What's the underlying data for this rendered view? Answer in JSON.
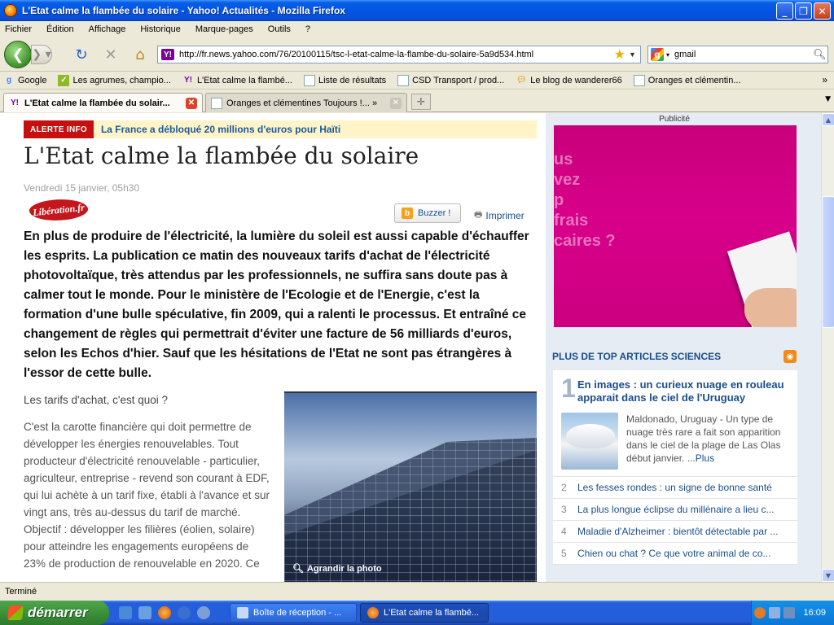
{
  "window": {
    "title": "L'Etat calme la flambée du solaire - Yahoo! Actualités - Mozilla Firefox"
  },
  "menu": [
    "Fichier",
    "Édition",
    "Affichage",
    "Historique",
    "Marque-pages",
    "Outils",
    "?"
  ],
  "nav": {
    "url": "http://fr.news.yahoo.com/76/20100115/tsc-l-etat-calme-la-flambe-du-solaire-5a9d534.html",
    "search_value": "gmail"
  },
  "bookmarks": [
    "Google",
    "Les agrumes, champio...",
    "L'Etat calme la flambé...",
    "Liste de résultats",
    "CSD Transport / prod...",
    "Le blog de wanderer66",
    "Oranges et clémentin..."
  ],
  "tabs": [
    {
      "label": "L'Etat calme la flambée du solair..."
    },
    {
      "label": "Oranges et clémentines Toujours !... »"
    }
  ],
  "article": {
    "alert_badge": "ALERTE INFO",
    "alert_text": "La France a débloqué 20 millions d'euros pour Haïti",
    "headline": "L'Etat calme la flambée du solaire",
    "date": "Vendredi 15 janvier, 05h30",
    "source_logo": "Libération.fr",
    "buzz_label": "Buzzer !",
    "print_label": "Imprimer",
    "lead": "En plus de produire de l'électricité, la lumière du soleil est aussi capable d'échauffer les esprits. La publication ce matin des nouveaux tarifs d'achat de l'électricité photovoltaïque, très attendus par les professionnels, ne suffira sans doute pas à calmer tout le monde. Pour le ministère de l'Ecologie et de l'Energie, c'est la formation d'une bulle spéculative, fin 2009, qui a ralenti le processus. Et entraîné ce changement de règles qui permettrait d'éviter une facture de 56 milliards d'euros, selon les Echos d'hier. Sauf que les hésitations de l'Etat ne sont pas étrangères à l'essor de cette bulle.",
    "subhead": "Les tarifs d'achat, c'est quoi ?",
    "body": "C'est la carotte financière qui doit permettre de développer les énergies renouvelables. Tout producteur d'électricité renouvelable - particulier, agriculteur, entreprise - revend son courant à EDF, qui lui achète à un tarif fixe, établi à l'avance et sur vingt ans, très au-dessus du tarif de marché. Objectif : développer les filières (éolien, solaire) pour atteindre les engagements européens de 23% de production de renouvelable en 2020. Ce",
    "photo_caption": "Agrandir la photo"
  },
  "sidebar": {
    "pub_label": "Publicité",
    "ad_lines": [
      "us",
      "vez",
      "p",
      "frais",
      "caires ?"
    ],
    "top_title": "PLUS DE TOP ARTICLES SCIENCES",
    "first": {
      "num": "1",
      "title": "En images : un curieux nuage en rouleau apparait dans le ciel de l'Uruguay",
      "desc": "Maldonado, Uruguay - Un type de nuage très rare a fait son apparition dans le ciel de la plage de Las Olas début janvier. ...",
      "more": "Plus"
    },
    "items": [
      {
        "num": "2",
        "text": "Les fesses rondes : un signe de bonne santé"
      },
      {
        "num": "3",
        "text": "La plus longue éclipse du millénaire a lieu c..."
      },
      {
        "num": "4",
        "text": "Maladie d'Alzheimer : bientôt détectable par ..."
      },
      {
        "num": "5",
        "text": "Chien ou chat ? Ce que votre animal de co..."
      }
    ]
  },
  "status": "Terminé",
  "taskbar": {
    "start": "démarrer",
    "tasks": [
      "Boîte de réception - ...",
      "L'Etat calme la flambé..."
    ],
    "clock": "16:09"
  }
}
